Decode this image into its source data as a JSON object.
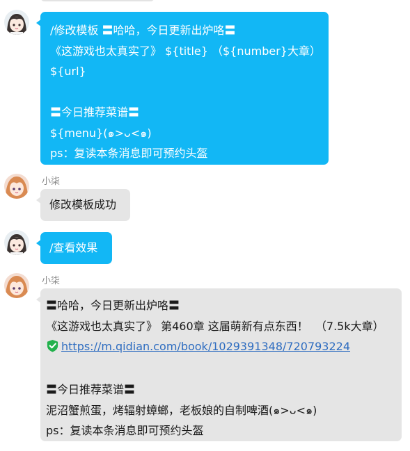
{
  "messages": [
    {
      "id": "m1",
      "lines": [
        "/修改模板 〓哈哈，今日更新出炉咯〓",
        "《这游戏也太真实了》 ${title} （${number}大章）",
        "${url}",
        "",
        "〓今日推荐菜谱〓",
        "${menu}(๑>ᴗ<๑)",
        "ps：复读本条消息即可预约头盔"
      ]
    },
    {
      "id": "m2",
      "sender": "小柒",
      "text": "修改模板成功"
    },
    {
      "id": "m3",
      "text": "/查看效果"
    },
    {
      "id": "m4",
      "sender": "小柒",
      "line1": "〓哈哈，今日更新出炉咯〓",
      "line2": "《这游戏也太真实了》 第460章 这届萌新有点东西！  （7.5k大章）",
      "link": "https://m.qidian.com/book/1029391348/720793224",
      "line4": "〓今日推荐菜谱〓",
      "line5": "泥沼蟹煎蛋，烤辐射蟑螂，老板娘的自制啤酒(๑>ᴗ<๑)",
      "line6": "ps：复读本条消息即可预约头盔"
    }
  ],
  "colors": {
    "blue_bubble": "#12b7f5",
    "gray_bubble": "#e5e5e5",
    "link": "#2d6cc0",
    "shield": "#22b14c"
  }
}
